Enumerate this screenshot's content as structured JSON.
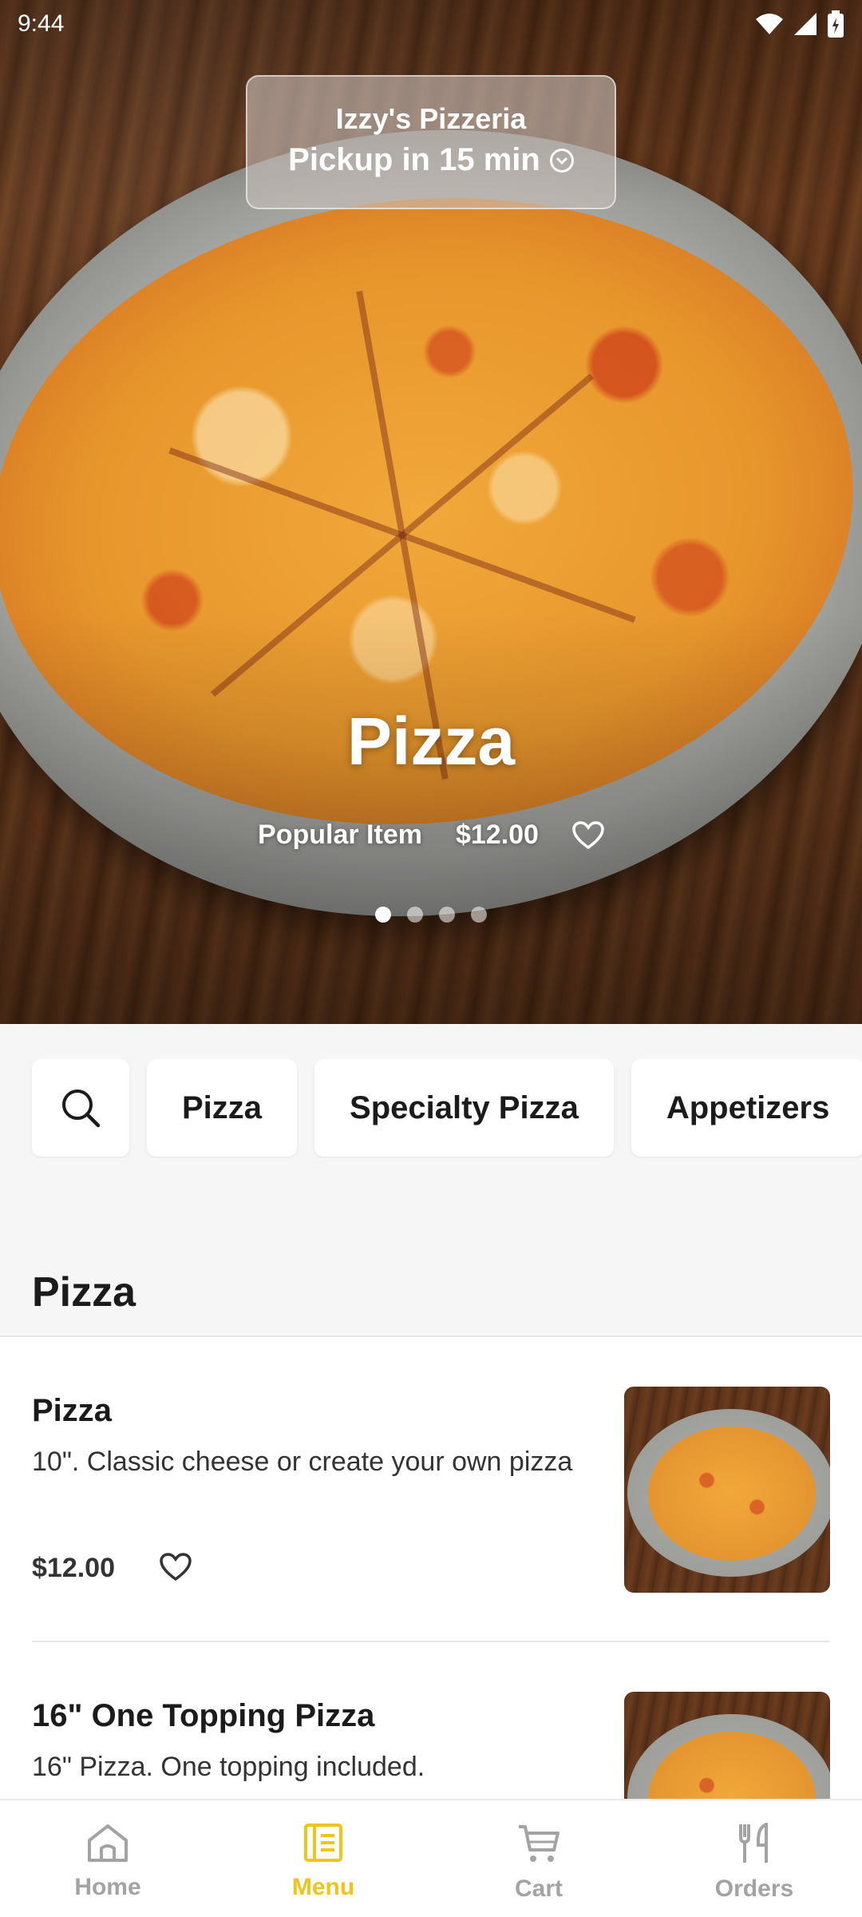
{
  "status_bar": {
    "time": "9:44"
  },
  "store": {
    "name": "Izzy's Pizzeria",
    "pickup": "Pickup in 15 min"
  },
  "hero": {
    "title": "Pizza",
    "tag": "Popular Item",
    "price": "$12.00",
    "carousel_pages": 4,
    "carousel_active_index": 0
  },
  "categories": [
    "Pizza",
    "Specialty Pizza",
    "Appetizers"
  ],
  "section": {
    "title": "Pizza"
  },
  "items": [
    {
      "name": "Pizza",
      "description": "10\". Classic cheese or create your own pizza",
      "price": "$12.00"
    },
    {
      "name": "16\" One Topping Pizza",
      "description": "16\" Pizza. One topping included."
    }
  ],
  "nav": [
    {
      "label": "Home",
      "icon": "home-icon"
    },
    {
      "label": "Menu",
      "icon": "menu-icon",
      "active": true
    },
    {
      "label": "Cart",
      "icon": "cart-icon"
    },
    {
      "label": "Orders",
      "icon": "orders-icon"
    }
  ],
  "colors": {
    "accent": "#f0c419",
    "inactive": "#a3a3a3"
  }
}
